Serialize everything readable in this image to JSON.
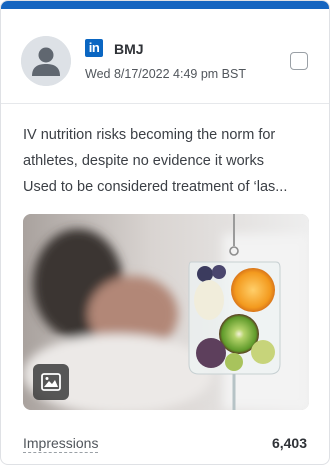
{
  "colors": {
    "accent": "#1565c0",
    "network_brand": "#0a66c2"
  },
  "post": {
    "network": "LinkedIn",
    "network_badge": "in",
    "network_icon": "linkedin-icon",
    "profile_name": "BMJ",
    "timestamp": "Wed 8/17/2022 4:49 pm BST",
    "text_lines": [
      "IV nutrition risks becoming the norm for",
      "athletes, despite no evidence it works",
      "Used to be considered treatment of ‘las..."
    ],
    "media_type_icon": "image-icon"
  },
  "metrics": {
    "impressions_label": "Impressions",
    "impressions_value": "6,403"
  }
}
